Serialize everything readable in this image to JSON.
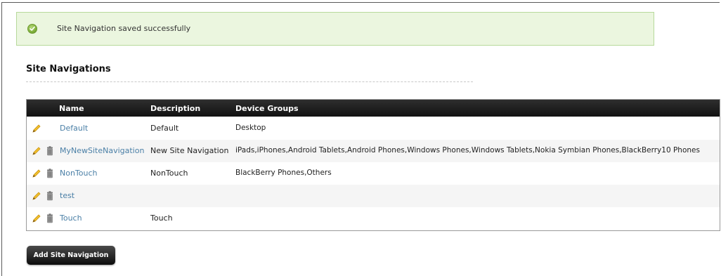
{
  "alert": {
    "message": "Site Navigation saved successfully",
    "status": "success",
    "icon": "check-circle-icon",
    "color": "#ebf6df"
  },
  "section": {
    "title": "Site Navigations"
  },
  "table": {
    "columns": {
      "name": "Name",
      "description": "Description",
      "device_groups": "Device Groups"
    },
    "rows": [
      {
        "name": "Default",
        "description": "Default",
        "device_groups": "Desktop",
        "editable": true,
        "deletable": false
      },
      {
        "name": "MyNewSiteNavigation",
        "description": "New Site Navigation",
        "device_groups": "iPads,iPhones,Android Tablets,Android Phones,Windows Phones,Windows Tablets,Nokia Symbian Phones,BlackBerry10 Phones",
        "editable": true,
        "deletable": true
      },
      {
        "name": "NonTouch",
        "description": "NonTouch",
        "device_groups": "BlackBerry Phones,Others",
        "editable": true,
        "deletable": true
      },
      {
        "name": "test",
        "description": "",
        "device_groups": "",
        "editable": true,
        "deletable": true
      },
      {
        "name": "Touch",
        "description": "Touch",
        "device_groups": "",
        "editable": true,
        "deletable": true
      }
    ],
    "header_color": "#1e1e1e",
    "link_color": "#4a7fa6"
  },
  "actions": {
    "add_label": "Add Site Navigation"
  }
}
